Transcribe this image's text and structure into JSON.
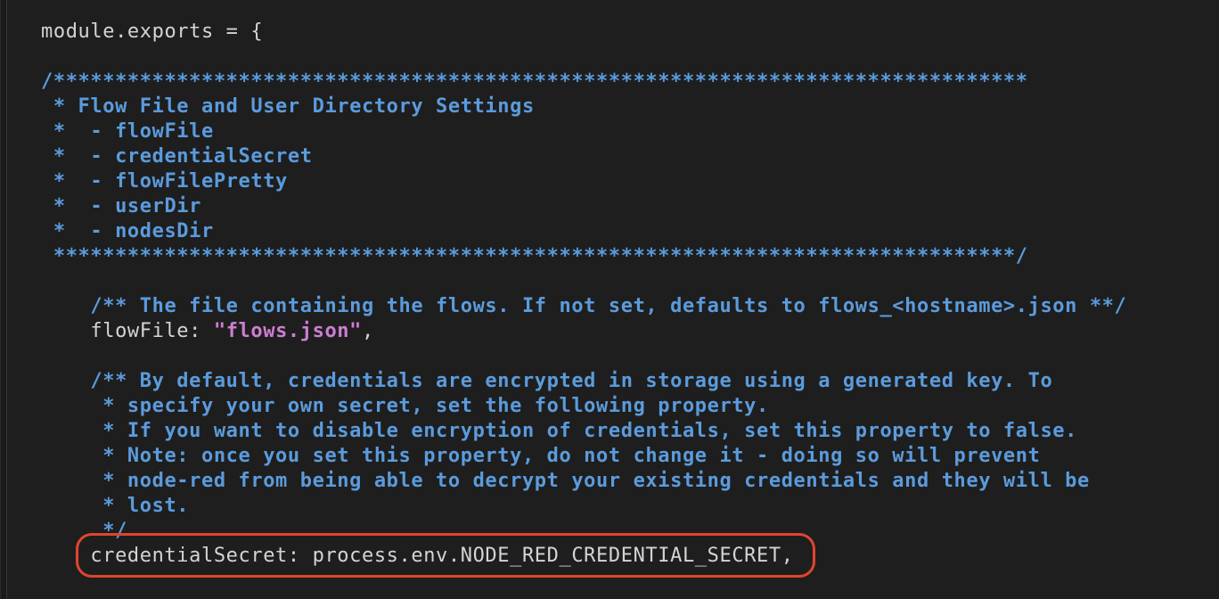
{
  "editor": {
    "lines": [
      {
        "segments": [
          {
            "text": "module.exports = {",
            "kind": "plain"
          }
        ]
      },
      {
        "segments": [
          {
            "text": "",
            "kind": "plain"
          }
        ]
      },
      {
        "segments": [
          {
            "text": "/*******************************************************************************",
            "kind": "comment"
          }
        ]
      },
      {
        "segments": [
          {
            "text": " * Flow File and User Directory Settings",
            "kind": "comment"
          }
        ]
      },
      {
        "segments": [
          {
            "text": " *  - flowFile",
            "kind": "comment"
          }
        ]
      },
      {
        "segments": [
          {
            "text": " *  - credentialSecret",
            "kind": "comment"
          }
        ]
      },
      {
        "segments": [
          {
            "text": " *  - flowFilePretty",
            "kind": "comment"
          }
        ]
      },
      {
        "segments": [
          {
            "text": " *  - userDir",
            "kind": "comment"
          }
        ]
      },
      {
        "segments": [
          {
            "text": " *  - nodesDir",
            "kind": "comment"
          }
        ]
      },
      {
        "segments": [
          {
            "text": " ******************************************************************************/",
            "kind": "comment"
          }
        ]
      },
      {
        "segments": [
          {
            "text": "",
            "kind": "plain"
          }
        ]
      },
      {
        "segments": [
          {
            "text": "    /** The file containing the flows. If not set, defaults to flows_<hostname>.json **/",
            "kind": "comment"
          }
        ]
      },
      {
        "segments": [
          {
            "text": "    flowFile: ",
            "kind": "plain"
          },
          {
            "text": "\"flows.json\"",
            "kind": "string"
          },
          {
            "text": ",",
            "kind": "plain"
          }
        ]
      },
      {
        "segments": [
          {
            "text": "",
            "kind": "plain"
          }
        ]
      },
      {
        "segments": [
          {
            "text": "    /** By default, credentials are encrypted in storage using a generated key. To",
            "kind": "comment"
          }
        ]
      },
      {
        "segments": [
          {
            "text": "     * specify your own secret, set the following property.",
            "kind": "comment"
          }
        ]
      },
      {
        "segments": [
          {
            "text": "     * If you want to disable encryption of credentials, set this property to false.",
            "kind": "comment"
          }
        ]
      },
      {
        "segments": [
          {
            "text": "     * Note: once you set this property, do not change it - doing so will prevent",
            "kind": "comment"
          }
        ]
      },
      {
        "segments": [
          {
            "text": "     * node-red from being able to decrypt your existing credentials and they will be",
            "kind": "comment"
          }
        ]
      },
      {
        "segments": [
          {
            "text": "     * lost.",
            "kind": "comment"
          }
        ]
      },
      {
        "segments": [
          {
            "text": "     */",
            "kind": "comment"
          }
        ]
      },
      {
        "segments": [
          {
            "text": "    credentialSecret: process.env.NODE_RED_CREDENTIAL_SECRET,",
            "kind": "plain"
          }
        ]
      }
    ]
  },
  "colors": {
    "background": "#1e1e1e",
    "plain_text": "#d4d4d4",
    "comment": "#5b9bdc",
    "string": "#ce7ed2",
    "highlight_outline": "#e0452e"
  }
}
